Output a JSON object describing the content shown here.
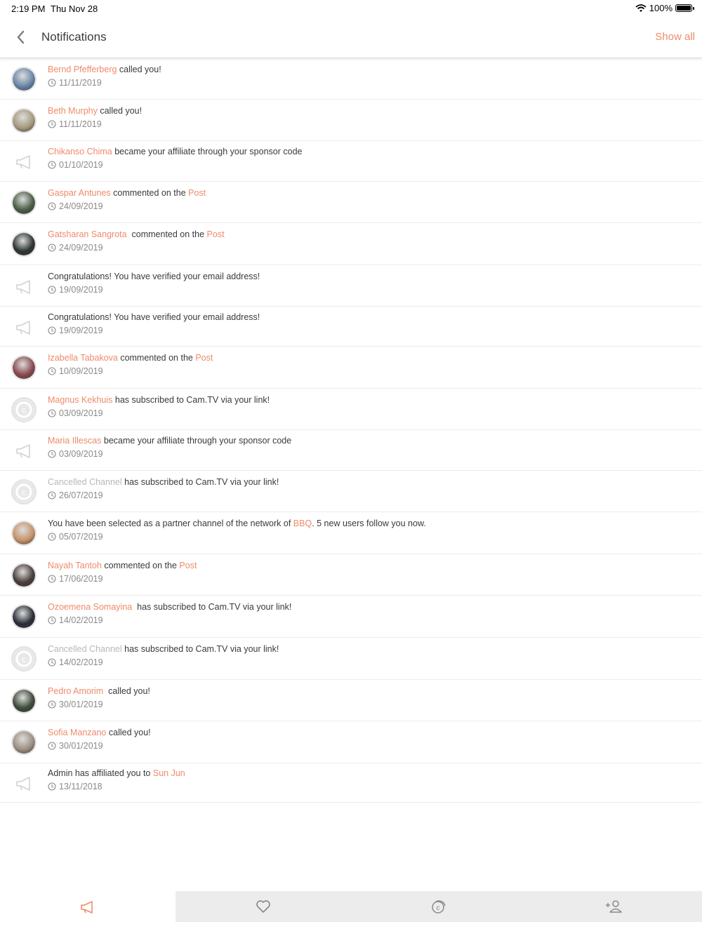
{
  "status": {
    "time": "2:19 PM",
    "date": "Thu Nov 28",
    "battery": "100%"
  },
  "nav": {
    "title": "Notifications",
    "show_all": "Show all"
  },
  "accent": "#ef8a6a",
  "notifications": [
    {
      "avatar": "photo",
      "avatar_color": "#6a86a8",
      "name": "Bernd Pfefferberg",
      "text": " called you!",
      "date": "11/11/2019"
    },
    {
      "avatar": "photo",
      "avatar_color": "#a79a7d",
      "name": "Beth Murphy",
      "text": " called you!",
      "date": "11/11/2019"
    },
    {
      "avatar": "megaphone",
      "name": "Chikanso Chima",
      "text": " became your affiliate through your sponsor code",
      "date": "01/10/2019"
    },
    {
      "avatar": "photo",
      "avatar_color": "#4a5e46",
      "name": "Gaspar Antunes",
      "text": " commented on the ",
      "link2": "Post",
      "date": "24/09/2019"
    },
    {
      "avatar": "photo",
      "avatar_color": "#2d3532",
      "name": "Gatsharan Sangrota",
      "text": "  commented on the ",
      "link2": "Post",
      "date": "24/09/2019"
    },
    {
      "avatar": "megaphone",
      "text": "Congratulations! You have verified your email address!",
      "date": "19/09/2019"
    },
    {
      "avatar": "megaphone",
      "text": "Congratulations! You have verified your email address!",
      "date": "19/09/2019"
    },
    {
      "avatar": "photo",
      "avatar_color": "#8a4a50",
      "name": "Izabella Tabakova",
      "text": " commented on the ",
      "link2": "Post",
      "date": "10/09/2019"
    },
    {
      "avatar": "camtv",
      "name": "Magnus Kekhuis",
      "text": " has subscribed to Cam.TV via your link!",
      "date": "03/09/2019"
    },
    {
      "avatar": "megaphone",
      "name": "Maria Illescas",
      "text": " became your affiliate through your sponsor code",
      "date": "03/09/2019"
    },
    {
      "avatar": "camtv",
      "name": "Cancelled Channel",
      "name_grey": true,
      "text": " has subscribed to Cam.TV via your link!",
      "date": "26/07/2019"
    },
    {
      "avatar": "photo",
      "avatar_color": "#c7936b",
      "text": "You have been selected as a partner channel of the network of ",
      "link2": "BBQ",
      "text2": ". 5 new users follow you now.",
      "date": "05/07/2019"
    },
    {
      "avatar": "photo",
      "avatar_color": "#4a3d3a",
      "name": "Nayah Tantoh",
      "text": " commented on the ",
      "link2": "Post",
      "date": "17/06/2019"
    },
    {
      "avatar": "photo",
      "avatar_color": "#2a2e38",
      "name": "Ozoemena Somayina",
      "text": "  has subscribed to Cam.TV via your link!",
      "date": "14/02/2019"
    },
    {
      "avatar": "camtv",
      "name": "Cancelled Channel",
      "name_grey": true,
      "text": " has subscribed to Cam.TV via your link!",
      "date": "14/02/2019"
    },
    {
      "avatar": "photo",
      "avatar_color": "#3e4a3a",
      "name": "Pedro Amorim",
      "text": "  called you!",
      "date": "30/01/2019"
    },
    {
      "avatar": "photo",
      "avatar_color": "#9d8f80",
      "name": "Sofia Manzano",
      "text": " called you!",
      "date": "30/01/2019"
    },
    {
      "avatar": "megaphone",
      "text": "Admin has affiliated you to ",
      "link2": "Sun Jun",
      "date": "13/11/2018"
    }
  ],
  "tabs": [
    {
      "icon": "megaphone-icon",
      "active": true
    },
    {
      "icon": "heart-icon",
      "active": false
    },
    {
      "icon": "cam-coin-icon",
      "active": false
    },
    {
      "icon": "add-user-icon",
      "active": false
    }
  ]
}
